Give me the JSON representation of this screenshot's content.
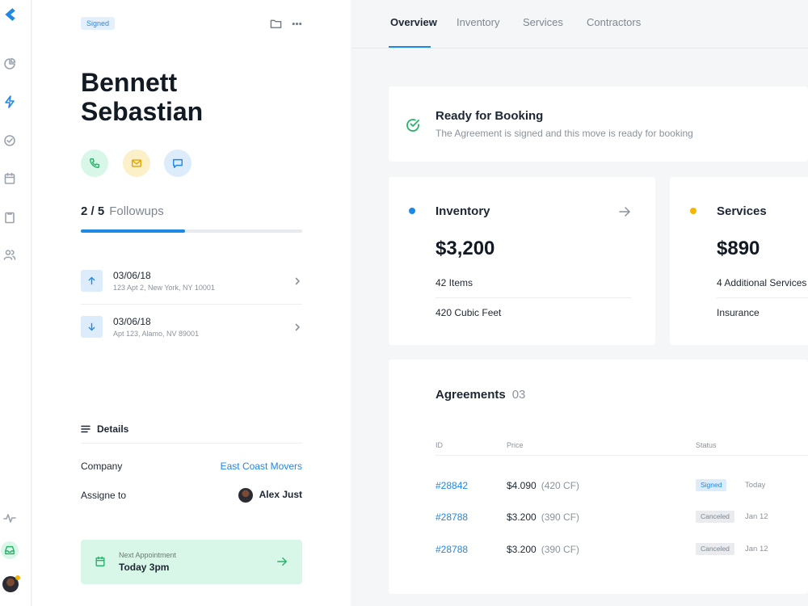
{
  "rail": {
    "icons": [
      "logo-icon",
      "pie-chart-icon",
      "lightning-icon",
      "check-circle-icon",
      "calendar-icon",
      "clipboard-icon",
      "users-icon",
      "activity-icon",
      "inbox-icon",
      "user-avatar"
    ]
  },
  "contact": {
    "badge": "Signed",
    "first_name": "Bennett",
    "last_name": "Sebastian",
    "followups_count": "2 / 5",
    "followups_label": "Followups",
    "followups_progress": 0.47,
    "addresses": [
      {
        "date": "03/06/18",
        "address": "123 Apt 2, New York, NY 10001",
        "direction": "up"
      },
      {
        "date": "03/06/18",
        "address": "Apt 123, Alamo, NV 89001",
        "direction": "down"
      }
    ],
    "details_heading": "Details",
    "company_label": "Company",
    "company_value": "East Coast Movers",
    "assignee_label": "Assigne to",
    "assignee_value": "Alex Just",
    "appointment_label": "Next Appointment",
    "appointment_value": "Today 3pm"
  },
  "tabs": [
    "Overview",
    "Inventory",
    "Services",
    "Contractors"
  ],
  "ready": {
    "title": "Ready for Booking",
    "subtitle": "The Agreement is signed and this move is ready for booking"
  },
  "inventory": {
    "title": "Inventory",
    "amount": "$3,200",
    "line1": "42 Items",
    "line2": "420 Cubic Feet"
  },
  "services": {
    "title": "Services",
    "amount": "$890",
    "line1": "4 Additional Services",
    "line2": "Insurance"
  },
  "agreements": {
    "title": "Agreements",
    "count": "03",
    "columns": [
      "ID",
      "Price",
      "Status"
    ],
    "rows": [
      {
        "id": "#28842",
        "price": "$4.090",
        "cf": "(420 CF)",
        "status": "Signed",
        "date": "Today"
      },
      {
        "id": "#28788",
        "price": "$3.200",
        "cf": "(390 CF)",
        "status": "Canceled",
        "date": "Jan 12"
      },
      {
        "id": "#28788",
        "price": "$3.200",
        "cf": "(390 CF)",
        "status": "Canceled",
        "date": "Jan 12"
      }
    ]
  },
  "colors": {
    "accent": "#1e88e5",
    "success": "#26b36b",
    "warning": "#f5b400",
    "background": "#f5f6f8"
  }
}
